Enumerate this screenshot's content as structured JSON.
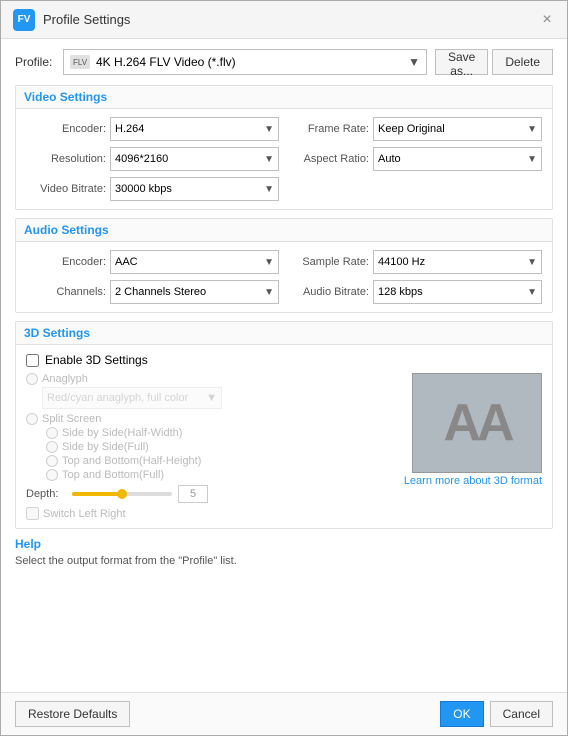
{
  "titleBar": {
    "title": "Profile Settings",
    "closeLabel": "×",
    "appIconLabel": "FV"
  },
  "profile": {
    "label": "Profile:",
    "value": "4K H.264 FLV Video (*.flv)",
    "iconLabel": "FLV",
    "saveAs": "Save as...",
    "delete": "Delete"
  },
  "videoSettings": {
    "title": "Video Settings",
    "encoder": {
      "label": "Encoder:",
      "value": "H.264",
      "arrow": "▼"
    },
    "frameRate": {
      "label": "Frame Rate:",
      "value": "Keep Original",
      "arrow": "▼"
    },
    "resolution": {
      "label": "Resolution:",
      "value": "4096*2160",
      "arrow": "▼"
    },
    "aspectRatio": {
      "label": "Aspect Ratio:",
      "value": "Auto",
      "arrow": "▼"
    },
    "videoBitrate": {
      "label": "Video Bitrate:",
      "value": "30000 kbps",
      "arrow": "▼"
    }
  },
  "audioSettings": {
    "title": "Audio Settings",
    "encoder": {
      "label": "Encoder:",
      "value": "AAC",
      "arrow": "▼"
    },
    "sampleRate": {
      "label": "Sample Rate:",
      "value": "44100 Hz",
      "arrow": "▼"
    },
    "channels": {
      "label": "Channels:",
      "value": "2 Channels Stereo",
      "arrow": "▼"
    },
    "audioBitrate": {
      "label": "Audio Bitrate:",
      "value": "128 kbps",
      "arrow": "▼"
    }
  },
  "d3Settings": {
    "title": "3D Settings",
    "enableLabel": "Enable 3D Settings",
    "anaglyphLabel": "Anaglyph",
    "anaglyphOption": "Red/cyan anaglyph, full color",
    "splitScreenLabel": "Split Screen",
    "splitOptions": [
      "Side by Side(Half-Width)",
      "Side by Side(Full)",
      "Top and Bottom(Half-Height)",
      "Top and Bottom(Full)"
    ],
    "depthLabel": "Depth:",
    "depthValue": "5",
    "switchLabel": "Switch Left Right",
    "learnMore": "Learn more about 3D format",
    "previewText": "AA"
  },
  "help": {
    "title": "Help",
    "text": "Select the output format from the \"Profile\" list."
  },
  "footer": {
    "restoreDefaults": "Restore Defaults",
    "ok": "OK",
    "cancel": "Cancel"
  }
}
